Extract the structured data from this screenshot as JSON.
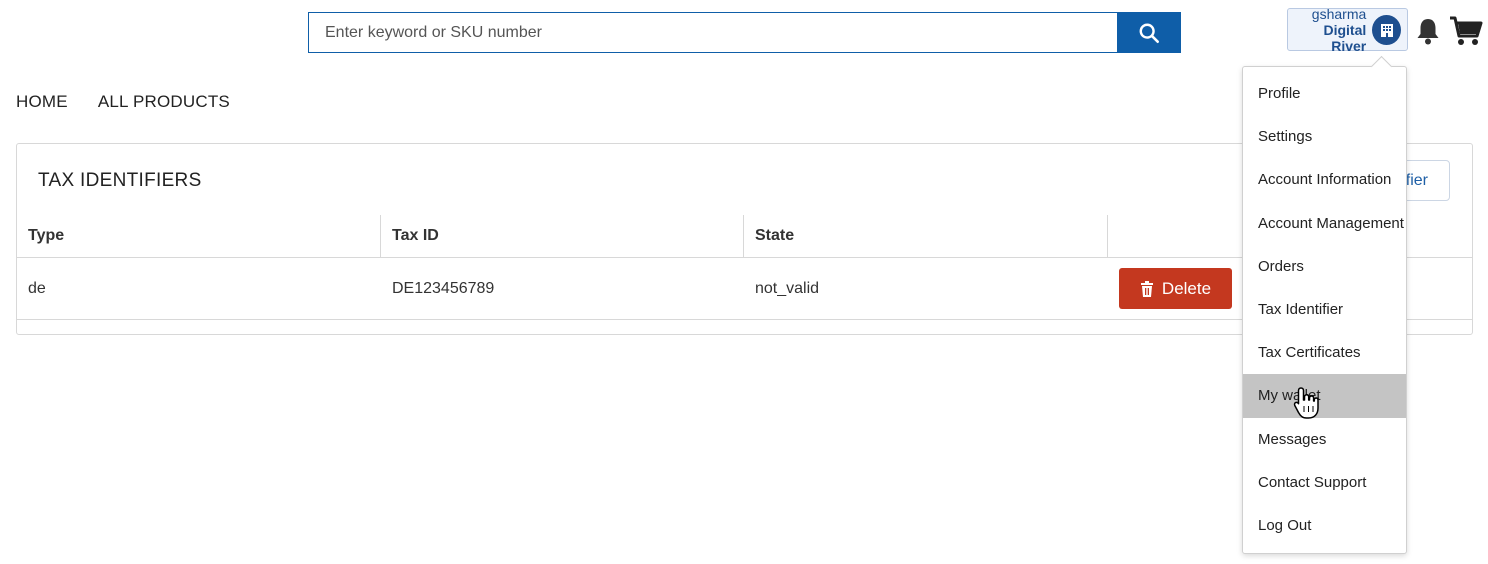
{
  "search": {
    "placeholder": "Enter keyword or SKU number",
    "icon": "search-icon"
  },
  "user": {
    "name": "gsharma",
    "organization": "Digital River",
    "icon": "building-icon"
  },
  "header_icons": {
    "bell": "bell-icon",
    "cart": "cart-icon"
  },
  "nav": {
    "items": [
      {
        "label": "HOME"
      },
      {
        "label": "ALL PRODUCTS"
      }
    ]
  },
  "panel": {
    "title": "TAX IDENTIFIERS",
    "add_button_label": "ifier",
    "columns": [
      "Type",
      "Tax ID",
      "State",
      ""
    ],
    "rows": [
      {
        "type": "de",
        "tax_id": "DE123456789",
        "state": "not_valid",
        "action_label": "Delete"
      }
    ]
  },
  "menu": {
    "items": [
      {
        "label": "Profile"
      },
      {
        "label": "Settings"
      },
      {
        "label": "Account Information"
      },
      {
        "label": "Account Management"
      },
      {
        "label": "Orders"
      },
      {
        "label": "Tax Identifier"
      },
      {
        "label": "Tax Certificates"
      },
      {
        "label": "My wallet"
      },
      {
        "label": "Messages"
      },
      {
        "label": "Contact Support"
      },
      {
        "label": "Log Out"
      }
    ],
    "highlighted": "My wallet"
  },
  "colors": {
    "primary": "#0f5ea8",
    "danger": "#c4381f",
    "highlight": "#c4c4c4",
    "brand_text": "#1e4f8f"
  }
}
